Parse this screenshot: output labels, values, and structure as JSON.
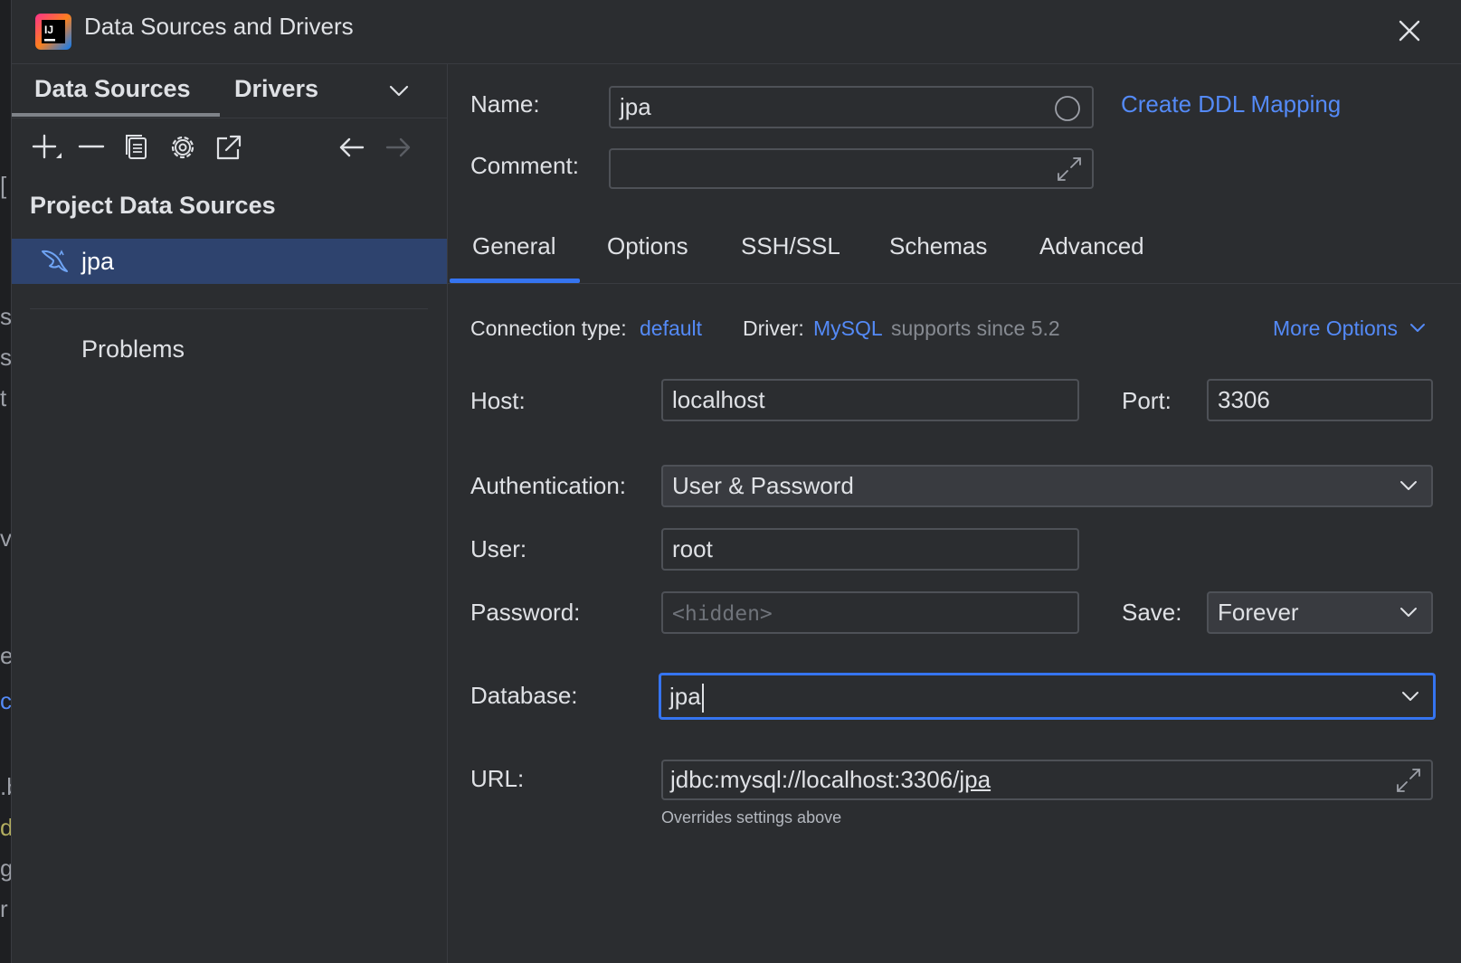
{
  "window": {
    "title": "Data Sources and Drivers"
  },
  "edge_glyphs": [
    "[",
    "s",
    "s",
    "t",
    "v",
    "e",
    "c",
    ".b",
    "d",
    "g",
    "r"
  ],
  "left": {
    "tabs": [
      {
        "label": "Data Sources",
        "active": true
      },
      {
        "label": "Drivers",
        "active": false
      }
    ],
    "toolbar": [
      "add-icon",
      "remove-icon",
      "duplicate-icon",
      "settings-icon",
      "open-external-icon",
      "back-arrow-icon",
      "forward-arrow-icon"
    ],
    "section_title": "Project Data Sources",
    "data_sources": [
      {
        "label": "jpa",
        "icon": "mysql-dolphin-icon",
        "selected": true
      }
    ],
    "problems_label": "Problems"
  },
  "form": {
    "name_label": "Name:",
    "name_value": "jpa",
    "comment_label": "Comment:",
    "comment_value": "",
    "ddl_link": "Create DDL Mapping",
    "tabs": [
      {
        "label": "General",
        "active": true
      },
      {
        "label": "Options",
        "active": false
      },
      {
        "label": "SSH/SSL",
        "active": false
      },
      {
        "label": "Schemas",
        "active": false
      },
      {
        "label": "Advanced",
        "active": false
      }
    ],
    "connection_type_label": "Connection type:",
    "connection_type_value": "default",
    "driver_label": "Driver:",
    "driver_value": "MySQL",
    "driver_note": "supports since 5.2",
    "more_options": "More Options",
    "host_label": "Host:",
    "host_value": "localhost",
    "port_label": "Port:",
    "port_value": "3306",
    "auth_label": "Authentication:",
    "auth_value": "User & Password",
    "user_label": "User:",
    "user_value": "root",
    "password_label": "Password:",
    "password_placeholder": "<hidden>",
    "save_label": "Save:",
    "save_value": "Forever",
    "database_label": "Database:",
    "database_value": "jpa",
    "url_label": "URL:",
    "url_prefix": "jdbc:mysql://localhost:3306/",
    "url_db": "jpa",
    "url_hint": "Overrides settings above"
  },
  "colors": {
    "background": "#2b2d30",
    "accent": "#3574f0",
    "link": "#548af7",
    "selection": "#2e436e"
  }
}
